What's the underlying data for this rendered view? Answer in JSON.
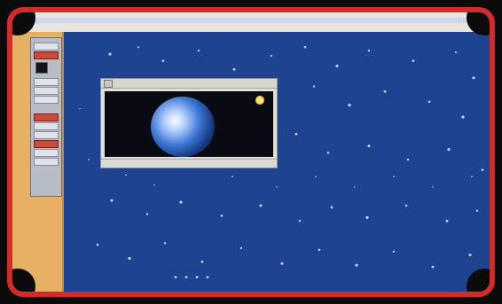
{
  "screen": {
    "colors": {
      "frame": "#d52a2a",
      "desktop": "#1e4390",
      "sidebar": "#e7b064",
      "window": "#dfe0da"
    }
  },
  "window": {
    "content": "earth-image"
  },
  "sidebar": {
    "icons": [
      "app-icon"
    ]
  }
}
